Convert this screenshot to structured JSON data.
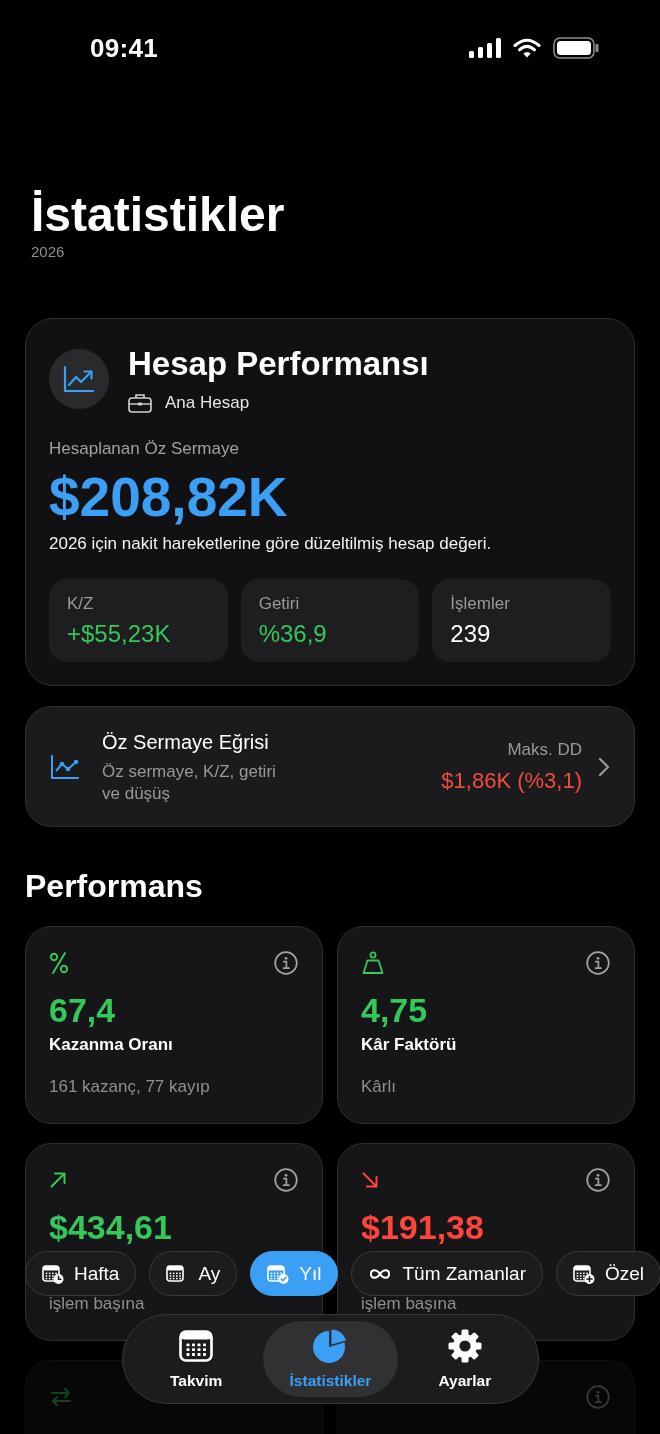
{
  "status_bar": {
    "time": "09:41"
  },
  "header": {
    "title": "İstatistikler",
    "subtitle": "2026"
  },
  "account_card": {
    "title": "Hesap Performansı",
    "account": "Ana Hesap",
    "equity_label": "Hesaplanan Öz Sermaye",
    "equity_value": "$208,82K",
    "description": "2026 için nakit hareketlerine göre düzeltilmiş hesap değeri.",
    "stats": [
      {
        "label": "K/Z",
        "value": "+$55,23K",
        "color": "#34c759"
      },
      {
        "label": "Getiri",
        "value": "%36,9",
        "color": "#34c759"
      },
      {
        "label": "İşlemler",
        "value": "239",
        "color": "#ffffff"
      }
    ]
  },
  "equity_curve": {
    "title": "Öz Sermaye Eğrisi",
    "subtitle": "Öz sermaye, K/Z, getiri ve düşüş",
    "metric_label": "Maks. DD",
    "metric_value": "$1,86K (%3,1)"
  },
  "performance": {
    "title": "Performans",
    "cards": [
      {
        "value": "67,4",
        "label": "Kazanma Oranı",
        "note": "161 kazanç, 77 kayıp",
        "color": "#34c759"
      },
      {
        "value": "4,75",
        "label": "Kâr Faktörü",
        "note": "Kârlı",
        "color": "#34c759"
      },
      {
        "value": "$434,61",
        "note": "işlem başına",
        "color": "#34c759"
      },
      {
        "value": "$191,38",
        "note": "işlem başına",
        "color": "#ff453a"
      }
    ]
  },
  "filters": [
    {
      "label": "Hafta",
      "selected": false
    },
    {
      "label": "Ay",
      "selected": false
    },
    {
      "label": "Yıl",
      "selected": true
    },
    {
      "label": "Tüm Zamanlar",
      "selected": false
    },
    {
      "label": "Özel",
      "selected": false
    }
  ],
  "tab_bar": [
    {
      "label": "Takvim",
      "selected": false
    },
    {
      "label": "İstatistikler",
      "selected": true
    },
    {
      "label": "Ayarlar",
      "selected": false
    }
  ]
}
